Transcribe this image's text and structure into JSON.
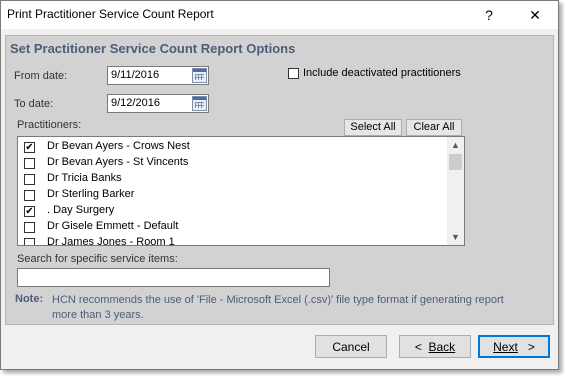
{
  "window": {
    "title": "Print Practitioner Service Count Report",
    "help_glyph": "?",
    "close_glyph": "✕"
  },
  "options": {
    "heading": "Set Practitioner Service Count Report Options",
    "from_date_label": "From date:",
    "from_date_value": "9/11/2016",
    "to_date_label": "To date:",
    "to_date_value": "9/12/2016",
    "include_deactivated_label": "Include deactivated practitioners",
    "include_deactivated_checked": false
  },
  "practitioners": {
    "label": "Practitioners:",
    "select_all_label": "Select All",
    "clear_all_label": "Clear All",
    "items": [
      {
        "label": "Dr Bevan Ayers - Crows Nest",
        "checked": true
      },
      {
        "label": "Dr Bevan Ayers - St Vincents",
        "checked": false
      },
      {
        "label": "Dr Tricia Banks",
        "checked": false
      },
      {
        "label": "Dr Sterling Barker",
        "checked": false
      },
      {
        "label": ". Day Surgery",
        "checked": true
      },
      {
        "label": "Dr Gisele Emmett - Default",
        "checked": false
      },
      {
        "label": "Dr James Jones - Room 1",
        "checked": false
      }
    ]
  },
  "search": {
    "label": "Search for specific service items:",
    "value": ""
  },
  "note": {
    "key": "Note:",
    "text": "HCN recommends the use of 'File - Microsoft Excel (.csv)' file type format if generating report more than 3 years."
  },
  "footer": {
    "cancel_label": "Cancel",
    "back_arrow": "<",
    "back_label": "Back",
    "next_label": "Next",
    "next_arrow": ">"
  }
}
